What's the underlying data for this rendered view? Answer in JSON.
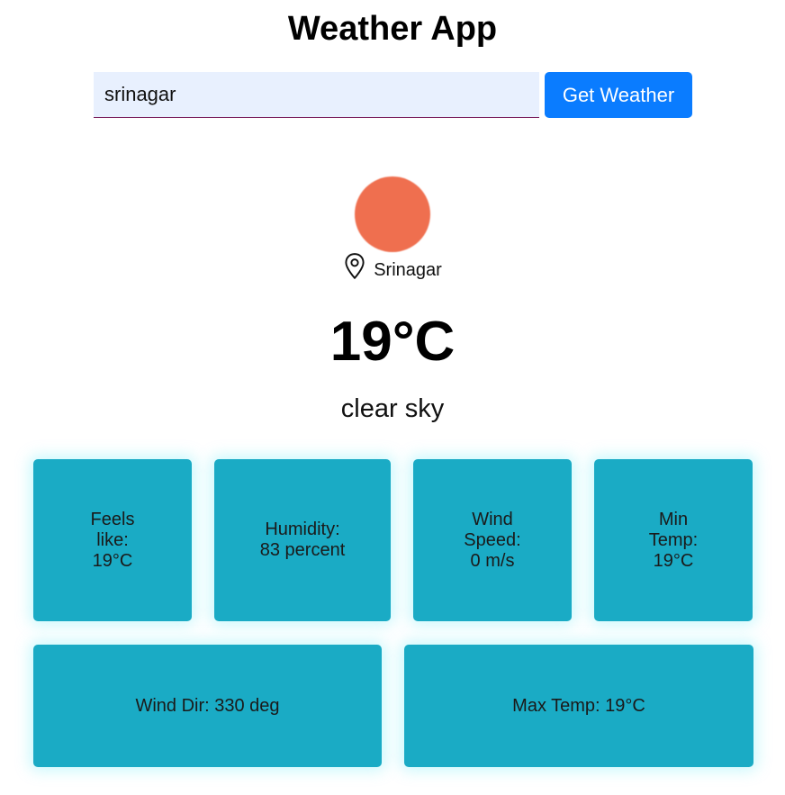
{
  "header": {
    "title": "Weather App"
  },
  "search": {
    "value": "srinagar",
    "button_label": "Get Weather"
  },
  "weather": {
    "icon": "sun-icon",
    "icon_color": "#ef6f4f",
    "location": "Srinagar",
    "temperature": "19°C",
    "description": "clear sky"
  },
  "details": {
    "feels_like": "Feels like: 19°C",
    "humidity": "Humidity: 83 percent",
    "wind_speed": "Wind Speed: 0 m/s",
    "min_temp": "Min Temp: 19°C",
    "wind_dir": "Wind Dir: 330 deg",
    "max_temp": "Max Temp: 19°C"
  },
  "colors": {
    "button": "#0a7cff",
    "card": "#1aabc5",
    "input_bg": "#e8f0fe"
  }
}
